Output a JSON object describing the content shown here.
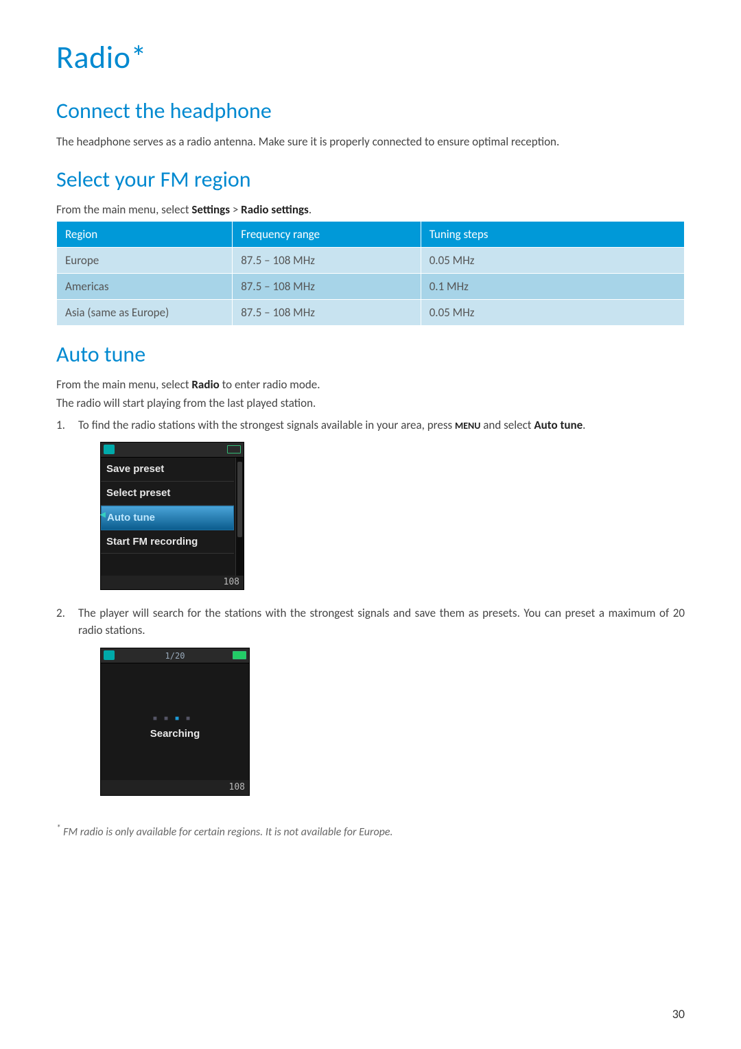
{
  "title": "Radio*",
  "sections": {
    "connect": {
      "heading": "Connect the headphone",
      "para": "The headphone serves as a radio antenna. Make sure it is properly connected to ensure optimal reception."
    },
    "region": {
      "heading": "Select your FM region",
      "intro_pre": "From the main menu, select ",
      "intro_b1": "Settings",
      "intro_mid": " > ",
      "intro_b2": "Radio settings",
      "intro_post": ".",
      "table": {
        "headers": {
          "c1": "Region",
          "c2": "Frequency range",
          "c3": "Tuning steps"
        },
        "rows": [
          {
            "c1": "Europe",
            "c2": "87.5 – 108 MHz",
            "c3": "0.05 MHz"
          },
          {
            "c1": "Americas",
            "c2": "87.5 – 108 MHz",
            "c3": "0.1 MHz"
          },
          {
            "c1": "Asia (same as Europe)",
            "c2": "87.5 – 108 MHz",
            "c3": "0.05 MHz"
          }
        ]
      }
    },
    "auto": {
      "heading": "Auto tune",
      "p1_pre": "From the main menu, select ",
      "p1_b": "Radio",
      "p1_post": " to enter radio mode.",
      "p2": "The radio will start playing from the last played station.",
      "step1_num": "1.",
      "step1_pre": "To find the radio stations with the strongest signals available in your area, press ",
      "step1_menu": "MENU",
      "step1_mid": " and select ",
      "step1_b": "Auto tune",
      "step1_post": ".",
      "step2_num": "2.",
      "step2": "The player will search for the stations with the strongest signals and save them as presets. You can preset a maximum of 20 radio stations."
    }
  },
  "device_menu": {
    "items": [
      "Save preset",
      "Select preset",
      "Auto tune",
      "Start FM recording"
    ],
    "selected_index": 2,
    "footer": "108"
  },
  "device_search": {
    "count": "1/20",
    "label": "Searching",
    "footer": "108"
  },
  "footnote": "FM radio is only available for certain regions. It is not available for Europe.",
  "footnote_ast": "*",
  "page_number": "30"
}
